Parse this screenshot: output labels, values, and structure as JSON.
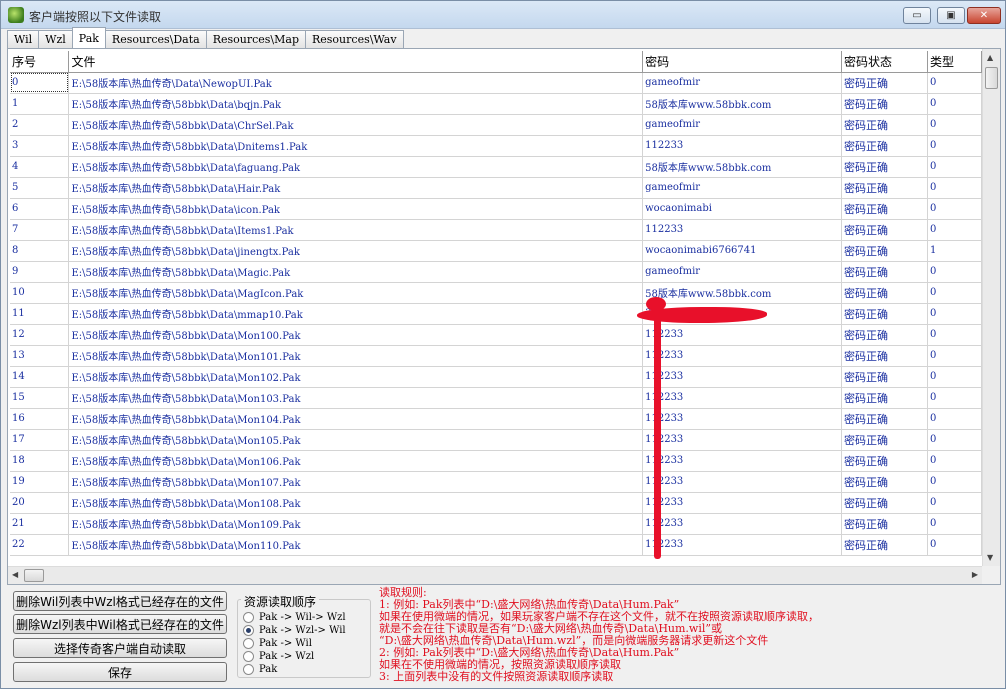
{
  "window": {
    "title": "客户端按照以下文件读取",
    "minimize_glyph": "▭",
    "maximize_glyph": "▣",
    "close_glyph": "✕"
  },
  "tabs": [
    {
      "label": "Wil",
      "active": false
    },
    {
      "label": "Wzl",
      "active": false
    },
    {
      "label": "Pak",
      "active": true
    },
    {
      "label": "Resources\\Data",
      "active": false
    },
    {
      "label": "Resources\\Map",
      "active": false
    },
    {
      "label": "Resources\\Wav",
      "active": false
    }
  ],
  "table": {
    "headers": [
      "序号",
      "文件",
      "密码",
      "密码状态",
      "类型"
    ],
    "rows": [
      [
        "0",
        "E:\\58版本库\\热血传奇\\Data\\NewopUI.Pak",
        "gameofmir",
        "密码正确",
        "0"
      ],
      [
        "1",
        "E:\\58版本库\\热血传奇\\58bbk\\Data\\bqjn.Pak",
        "58版本库www.58bbk.com",
        "密码正确",
        "0"
      ],
      [
        "2",
        "E:\\58版本库\\热血传奇\\58bbk\\Data\\ChrSel.Pak",
        "gameofmir",
        "密码正确",
        "0"
      ],
      [
        "3",
        "E:\\58版本库\\热血传奇\\58bbk\\Data\\Dnitems1.Pak",
        "112233",
        "密码正确",
        "0"
      ],
      [
        "4",
        "E:\\58版本库\\热血传奇\\58bbk\\Data\\faguang.Pak",
        "58版本库www.58bbk.com",
        "密码正确",
        "0"
      ],
      [
        "5",
        "E:\\58版本库\\热血传奇\\58bbk\\Data\\Hair.Pak",
        "gameofmir",
        "密码正确",
        "0"
      ],
      [
        "6",
        "E:\\58版本库\\热血传奇\\58bbk\\Data\\icon.Pak",
        "wocaonimabi",
        "密码正确",
        "0"
      ],
      [
        "7",
        "E:\\58版本库\\热血传奇\\58bbk\\Data\\Items1.Pak",
        "112233",
        "密码正确",
        "0"
      ],
      [
        "8",
        "E:\\58版本库\\热血传奇\\58bbk\\Data\\jinengtx.Pak",
        "wocaonimabi6766741",
        "密码正确",
        "1"
      ],
      [
        "9",
        "E:\\58版本库\\热血传奇\\58bbk\\Data\\Magic.Pak",
        "gameofmir",
        "密码正确",
        "0"
      ],
      [
        "10",
        "E:\\58版本库\\热血传奇\\58bbk\\Data\\MagIcon.Pak",
        "58版本库www.58bbk.com",
        "密码正确",
        "0"
      ],
      [
        "11",
        "E:\\58版本库\\热血传奇\\58bbk\\Data\\mmap10.Pak",
        "3",
        "密码正确",
        "0"
      ],
      [
        "12",
        "E:\\58版本库\\热血传奇\\58bbk\\Data\\Mon100.Pak",
        "112233",
        "密码正确",
        "0"
      ],
      [
        "13",
        "E:\\58版本库\\热血传奇\\58bbk\\Data\\Mon101.Pak",
        "112233",
        "密码正确",
        "0"
      ],
      [
        "14",
        "E:\\58版本库\\热血传奇\\58bbk\\Data\\Mon102.Pak",
        "112233",
        "密码正确",
        "0"
      ],
      [
        "15",
        "E:\\58版本库\\热血传奇\\58bbk\\Data\\Mon103.Pak",
        "112233",
        "密码正确",
        "0"
      ],
      [
        "16",
        "E:\\58版本库\\热血传奇\\58bbk\\Data\\Mon104.Pak",
        "112233",
        "密码正确",
        "0"
      ],
      [
        "17",
        "E:\\58版本库\\热血传奇\\58bbk\\Data\\Mon105.Pak",
        "112233",
        "密码正确",
        "0"
      ],
      [
        "18",
        "E:\\58版本库\\热血传奇\\58bbk\\Data\\Mon106.Pak",
        "112233",
        "密码正确",
        "0"
      ],
      [
        "19",
        "E:\\58版本库\\热血传奇\\58bbk\\Data\\Mon107.Pak",
        "112233",
        "密码正确",
        "0"
      ],
      [
        "20",
        "E:\\58版本库\\热血传奇\\58bbk\\Data\\Mon108.Pak",
        "112233",
        "密码正确",
        "0"
      ],
      [
        "21",
        "E:\\58版本库\\热血传奇\\58bbk\\Data\\Mon109.Pak",
        "112233",
        "密码正确",
        "0"
      ],
      [
        "22",
        "E:\\58版本库\\热血传奇\\58bbk\\Data\\Mon110.Pak",
        "112233",
        "密码正确",
        "0"
      ]
    ]
  },
  "buttons": {
    "delete_wil": "删除Wil列表中Wzl格式已经存在的文件",
    "delete_wzl": "删除Wzl列表中Wil格式已经存在的文件",
    "auto_read": "选择传奇客户端自动读取",
    "save": "保存"
  },
  "read_order": {
    "title": "资源读取顺序",
    "options": [
      {
        "label": "Pak -> Wil-> Wzl",
        "checked": false
      },
      {
        "label": "Pak -> Wzl-> Wil",
        "checked": true
      },
      {
        "label": "Pak -> Wil",
        "checked": false
      },
      {
        "label": "Pak -> Wzl",
        "checked": false
      },
      {
        "label": "Pak",
        "checked": false
      }
    ]
  },
  "rules": {
    "lines": [
      "读取规则:",
      "1: 例如: Pak列表中“D:\\盛大网络\\热血传奇\\Data\\Hum.Pak”",
      "    如果在使用微端的情况，如果玩家客户端不存在这个文件，就不在按照资源读取顺序读取，",
      "    就是不会在往下读取是否有“D:\\盛大网络\\热血传奇\\Data\\Hum.wil”或",
      "   “D:\\盛大网络\\热血传奇\\Data\\Hum.wzl”，而是向微端服务器请求更新这个文件",
      "2: 例如: Pak列表中“D:\\盛大网络\\热血传奇\\Data\\Hum.Pak”",
      "    如果在不使用微端的情况，按照资源读取顺序读取",
      "3: 上面列表中没有的文件按照资源读取顺序读取"
    ]
  },
  "colors": {
    "cell_text": "#1a2fa0",
    "rules_text": "#e01020",
    "annotation": "#e8102a"
  }
}
